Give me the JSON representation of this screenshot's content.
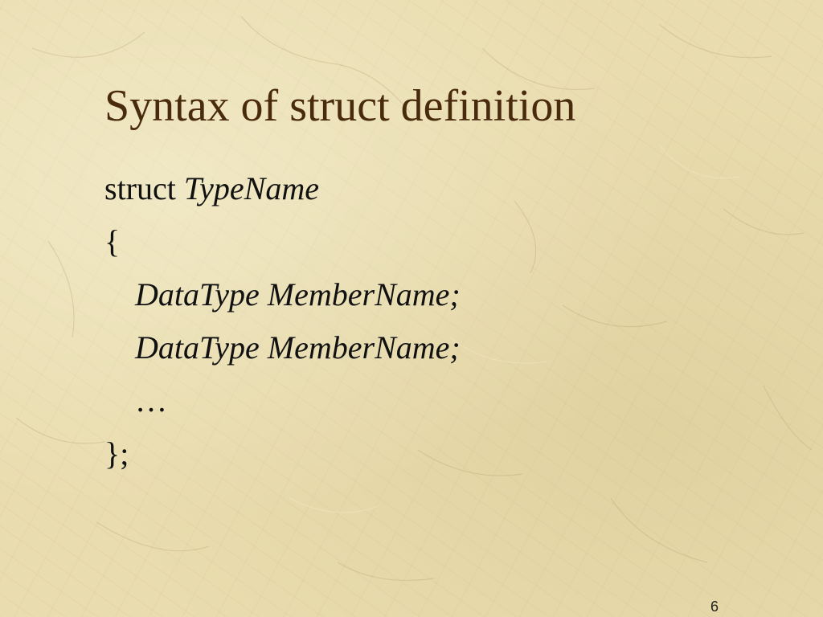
{
  "slide": {
    "title": "Syntax of struct definition",
    "code": {
      "keyword": "struct",
      "type_name": "TypeName",
      "open_brace": "{",
      "members": [
        "DataType MemberName;",
        "DataType MemberName;"
      ],
      "ellipsis": "…",
      "close_brace": "};"
    },
    "page_number": "6"
  },
  "colors": {
    "background": "#e9dcae",
    "title": "#4a2a0c",
    "text": "#111111"
  }
}
